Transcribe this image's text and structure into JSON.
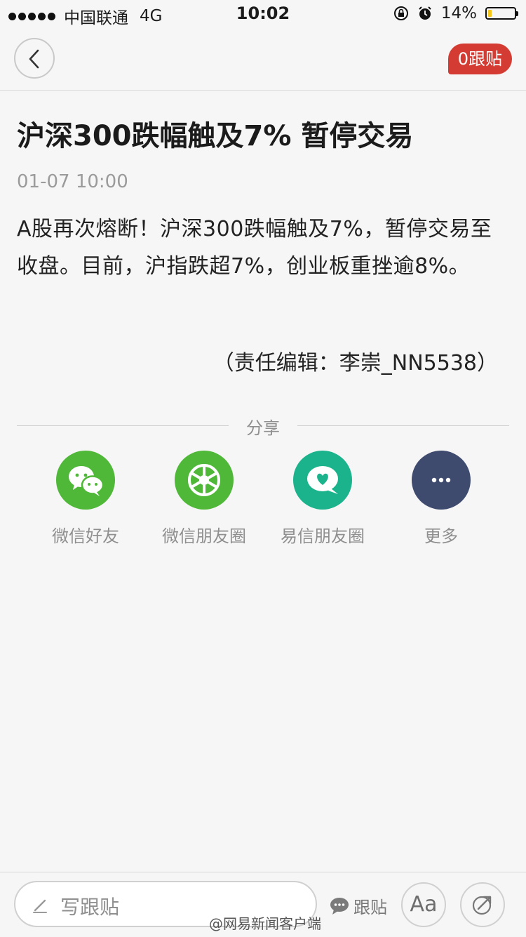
{
  "status_bar": {
    "carrier": "中国联通",
    "network": "4G",
    "time": "10:02",
    "battery": "14%",
    "battery_level": 0.14
  },
  "nav": {
    "follow_count_label": "0跟贴"
  },
  "article": {
    "title": "沪深300跌幅触及7% 暂停交易",
    "time": "01-07 10:00",
    "body": "A股再次熔断！沪深300跌幅触及7%，暂停交易至收盘。目前，沪指跌超7%，创业板重挫逾8%。",
    "editor": "（责任编辑：李崇_NN5538）"
  },
  "share": {
    "label": "分享",
    "items": [
      {
        "label": "微信好友",
        "icon": "wechat-icon",
        "color": "#4fb838"
      },
      {
        "label": "微信朋友圈",
        "icon": "wechat-moments-icon",
        "color": "#4fb838"
      },
      {
        "label": "易信朋友圈",
        "icon": "yixin-moments-icon",
        "color": "#1bb38c"
      },
      {
        "label": "更多",
        "icon": "more-icon",
        "color": "#3f4b6e"
      }
    ]
  },
  "bottom_bar": {
    "comment_placeholder": "写跟贴",
    "follow_link": "跟贴",
    "font_button": "Aa"
  },
  "watermark": "@网易新闻客户端",
  "colors": {
    "accent_red": "#d43c33",
    "background": "#f6f6f6"
  }
}
